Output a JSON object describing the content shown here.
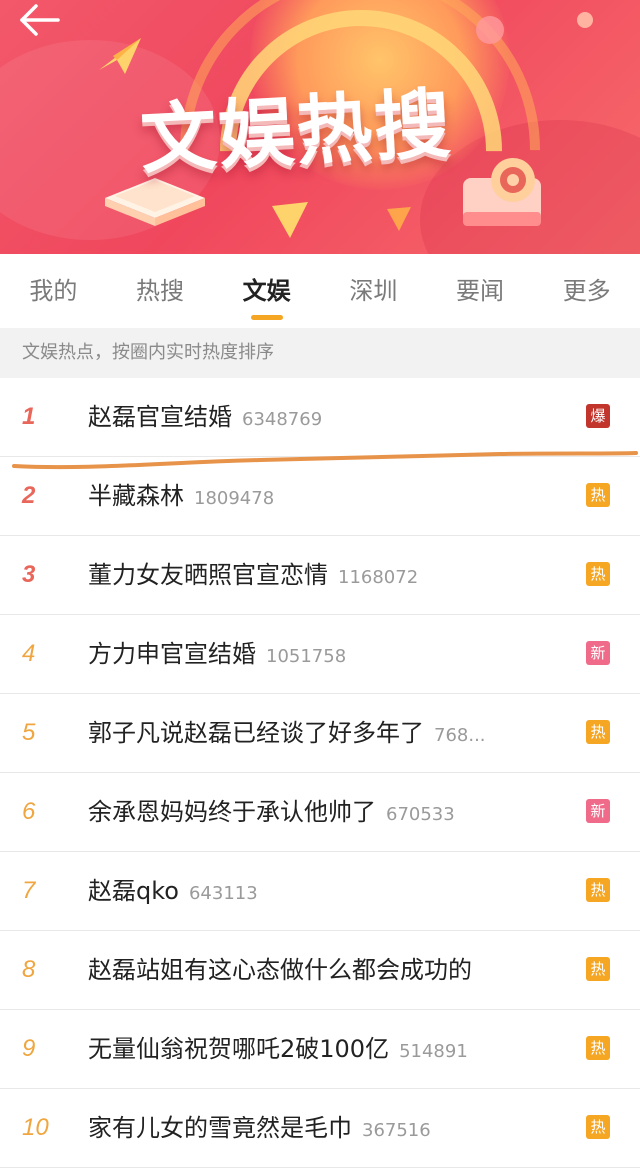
{
  "banner": {
    "title": "文娱热搜",
    "back_icon": "arrow-left-icon"
  },
  "tabs": [
    {
      "label": "我的",
      "active": false
    },
    {
      "label": "热搜",
      "active": false
    },
    {
      "label": "文娱",
      "active": true
    },
    {
      "label": "深圳",
      "active": false
    },
    {
      "label": "要闻",
      "active": false
    },
    {
      "label": "更多",
      "active": false
    }
  ],
  "subheader": "文娱热点，按圈内实时热度排序",
  "list": [
    {
      "rank": "1",
      "title": "赵磊官宣结婚",
      "count": "6348769",
      "badge": "爆",
      "badge_type": "bao"
    },
    {
      "rank": "2",
      "title": "半藏森林",
      "count": "1809478",
      "badge": "热",
      "badge_type": "re"
    },
    {
      "rank": "3",
      "title": "董力女友晒照官宣恋情",
      "count": "1168072",
      "badge": "热",
      "badge_type": "re"
    },
    {
      "rank": "4",
      "title": "方力申官宣结婚",
      "count": "1051758",
      "badge": "新",
      "badge_type": "xin"
    },
    {
      "rank": "5",
      "title": "郭子凡说赵磊已经谈了好多年了",
      "count": "768...",
      "badge": "热",
      "badge_type": "re"
    },
    {
      "rank": "6",
      "title": "余承恩妈妈终于承认他帅了",
      "count": "670533",
      "badge": "新",
      "badge_type": "xin"
    },
    {
      "rank": "7",
      "title": "赵磊qko",
      "count": "643113",
      "badge": "热",
      "badge_type": "re"
    },
    {
      "rank": "8",
      "title": "赵磊站姐有这心态做什么都会成功的",
      "count": "",
      "badge": "热",
      "badge_type": "re"
    },
    {
      "rank": "9",
      "title": "无量仙翁祝贺哪吒2破100亿",
      "count": "514891",
      "badge": "热",
      "badge_type": "re"
    },
    {
      "rank": "10",
      "title": "家有儿女的雪竟然是毛巾",
      "count": "367516",
      "badge": "热",
      "badge_type": "re"
    }
  ],
  "colors": {
    "accent": "#f5a623",
    "rank_top": "#e8665a",
    "rank_rest": "#f0a640",
    "badge_bao": "#c2352c",
    "badge_re": "#f5a623",
    "badge_xin": "#f06b8a",
    "annotation_stroke": "#e8934a"
  }
}
